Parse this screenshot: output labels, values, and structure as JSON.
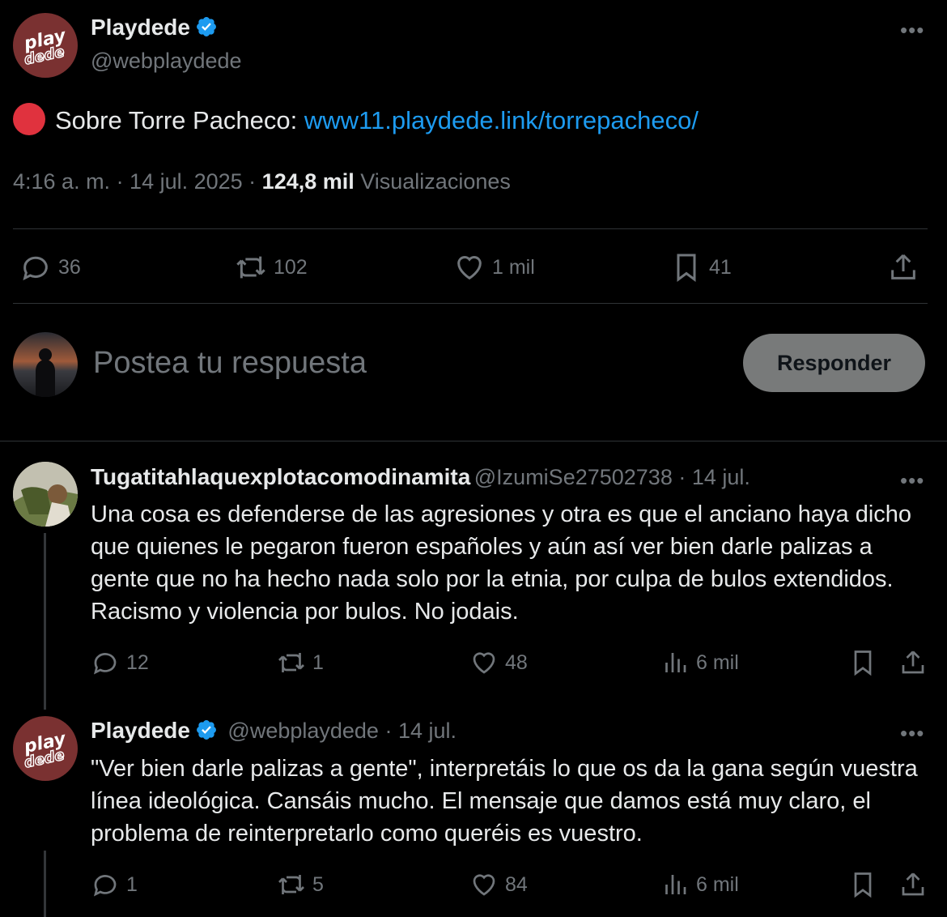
{
  "main_tweet": {
    "author_name": "Playdede",
    "author_handle": "@webplaydede",
    "avatar_text": "play dede",
    "emoji": "red-circle",
    "text_prefix": "Sobre Torre Pacheco: ",
    "link": "www11.playdede.link/torrepacheco/",
    "time": "4:16 a. m. · 14 jul. 2025 · ",
    "views_count": "124,8 mil",
    "views_label": " Visualizaciones",
    "stats": {
      "replies": "36",
      "retweets": "102",
      "likes": "1 mil",
      "bookmarks": "41"
    }
  },
  "compose": {
    "placeholder": "Postea tu respuesta",
    "button": "Responder"
  },
  "replies": [
    {
      "author_name": "Tugatitahlaquexplotacomodinamita",
      "author_handle": "@IzumiSe27502738",
      "date": " · 14 jul.",
      "text": "Una cosa es defenderse de las agresiones y otra es que el anciano haya dicho que quienes le pegaron fueron españoles y aún así ver bien darle palizas a gente que no ha hecho nada solo por la etnia, por culpa de bulos extendidos. Racismo y violencia por bulos. No jodais.",
      "stats": {
        "replies": "12",
        "retweets": "1",
        "likes": "48",
        "views": "6 mil"
      }
    },
    {
      "author_name": "Playdede",
      "author_handle": "@webplaydede",
      "date": " · 14 jul.",
      "text": "\"Ver bien darle palizas a gente\", interpretáis lo que os da la gana según vuestra línea ideológica. Cansáis mucho. El mensaje que damos está muy claro, el problema de reinterpretarlo como queréis es vuestro.",
      "stats": {
        "replies": "1",
        "retweets": "5",
        "likes": "84",
        "views": "6 mil"
      }
    }
  ],
  "colors": {
    "background": "#000000",
    "text": "#e7e9ea",
    "secondary": "#71767b",
    "link": "#1d9bf0",
    "verified": "#1d9bf0",
    "divider": "#2f3336",
    "avatar_brand": "#7a3131",
    "red_circle": "#e0323e"
  }
}
